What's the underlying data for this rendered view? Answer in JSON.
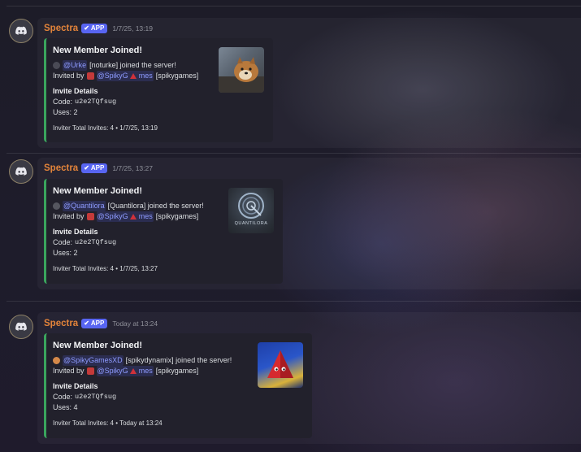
{
  "colors": {
    "accent_name": "#e3843a",
    "embed_border": "#3aa55d",
    "mention": "#8e9bff",
    "badge": "#5865f2"
  },
  "messages": [
    {
      "username": "Spectra",
      "badge": "APP",
      "timestamp": "1/7/25, 13:19",
      "embed": {
        "title": "New Member Joined!",
        "joined_mention": "@Urke",
        "joined_rest": "[noturke] joined the server!",
        "invited_prefix": "Invited by",
        "inviter_mention_a": "@SpikyG",
        "inviter_mention_b": "mes",
        "inviter_rest": "[spikygames]",
        "details_title": "Invite Details",
        "code_label": "Code:",
        "code": "u2e2TQfsug",
        "uses": "Uses: 2",
        "footer": "Inviter Total Invites: 4 • 1/7/25, 13:19",
        "thumbnail_icon": "dog-photo-icon"
      }
    },
    {
      "username": "Spectra",
      "badge": "APP",
      "timestamp": "1/7/25, 13:27",
      "embed": {
        "title": "New Member Joined!",
        "joined_mention": "@Quantilora",
        "joined_rest": "[Quantilora] joined the server!",
        "invited_prefix": "Invited by",
        "inviter_mention_a": "@SpikyG",
        "inviter_mention_b": "mes",
        "inviter_rest": "[spikygames]",
        "details_title": "Invite Details",
        "code_label": "Code:",
        "code": "u2e2TQfsug",
        "uses": "Uses: 2",
        "footer": "Inviter Total Invites: 4 • 1/7/25, 13:27",
        "thumbnail_text": "QUANTILORA",
        "thumbnail_icon": "quantilora-logo-icon"
      }
    },
    {
      "username": "Spectra",
      "badge": "APP",
      "timestamp": "Today at 13:24",
      "embed": {
        "title": "New Member Joined!",
        "joined_mention": "@SpikyGamesXD",
        "joined_rest": "[spikydynamix] joined the server!",
        "invited_prefix": "Invited by",
        "inviter_mention_a": "@SpikyG",
        "inviter_mention_b": "mes",
        "inviter_rest": "[spikygames]",
        "details_title": "Invite Details",
        "code_label": "Code:",
        "code": "u2e2TQfsug",
        "uses": "Uses: 4",
        "footer": "Inviter Total Invites: 4 • Today at 13:24",
        "thumbnail_icon": "red-cone-avatar-icon"
      }
    }
  ]
}
